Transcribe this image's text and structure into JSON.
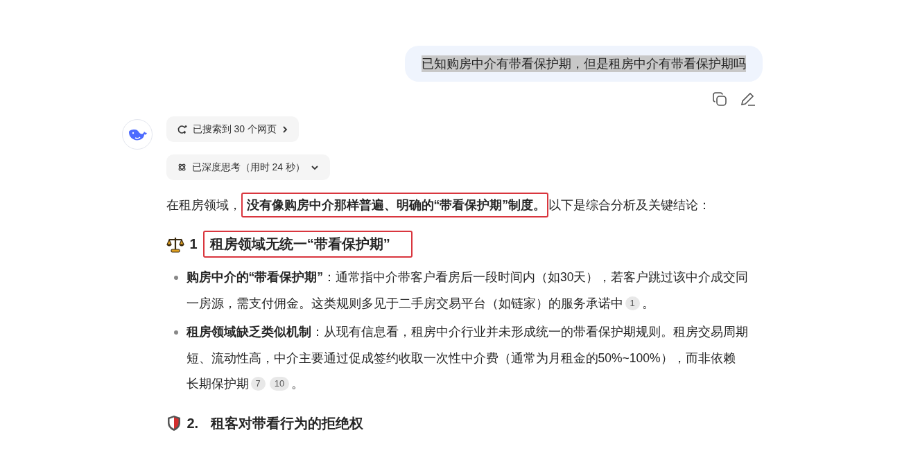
{
  "user_message": {
    "text": "已知购房中介有带看保护期，但是租房中介有带看保护期吗",
    "text_selected": true
  },
  "assistant": {
    "steps": [
      {
        "kind": "search",
        "label": "已搜索到 30 个网页"
      },
      {
        "kind": "thinking",
        "label": "已深度思考（用时 24 秒）"
      }
    ],
    "intro": {
      "before": "在租房领域，",
      "highlight": "没有像购房中介那样普遍、明确的“带看保护期”制度。",
      "after": "以下是综合分析及关键结论："
    },
    "sections": [
      {
        "number": "1",
        "title": "租房领域无统一“带看保护期”",
        "highlighted": true,
        "bullets": [
          {
            "lines": [
              "**购房中介的“带看保护期”**：通常指中介带客户看房后一段时间内（如30天），若客户跳过该中介成交同",
              "一房源，需支付佣金。这类规则多见于二手房交易平台（如链家）的服务承诺中"
            ],
            "citations": [
              "1"
            ],
            "tail": "。"
          },
          {
            "lines": [
              "**租房领域缺乏类似机制**：从现有信息看，租房中介行业并未形成统一的带看保护期规则。租房交易周期",
              "短、流动性高，中介主要通过促成签约收取一次性中介费（通常为月租金的50%~100%），而非依赖",
              "长期保护期"
            ],
            "citations": [
              "7",
              "10"
            ],
            "tail": "。"
          }
        ]
      },
      {
        "number": "2.",
        "title": "租客对带看行为的拒绝权",
        "highlighted": false
      }
    ]
  }
}
